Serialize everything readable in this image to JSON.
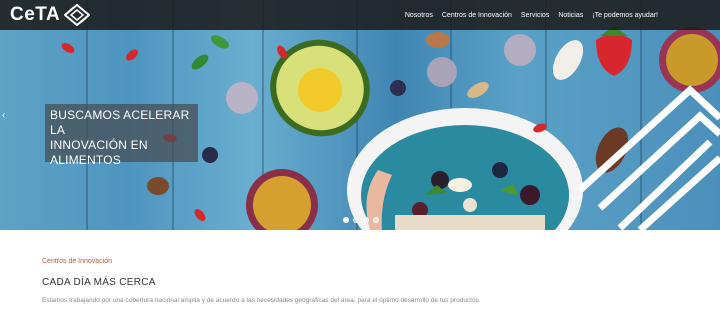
{
  "brand": {
    "name": "CeTA"
  },
  "nav": {
    "items": [
      {
        "label": "Nosotros"
      },
      {
        "label": "Centros de Innovación"
      },
      {
        "label": "Servicios"
      },
      {
        "label": "Noticias"
      },
      {
        "label": "¡Te podemos ayudar!"
      }
    ]
  },
  "hero": {
    "caption": [
      "BUSCAMOS ACELERAR LA",
      "INNOVACIÓN EN",
      "ALIMENTOS"
    ],
    "slides_total": 4,
    "active_slide": 1
  },
  "section": {
    "label": "Centros de Innovación",
    "title": "CADA DÍA MÁS CERCA",
    "body": "Estamos trabajando por una cobertura nacional amplia y de acuerdo a las necesidades geográficas del área, para el óptimo desarrollo de tus productos."
  },
  "colors": {
    "navbar": "#1c1c1c",
    "accent": "#b35a3a",
    "wood": "#4e95bf"
  }
}
